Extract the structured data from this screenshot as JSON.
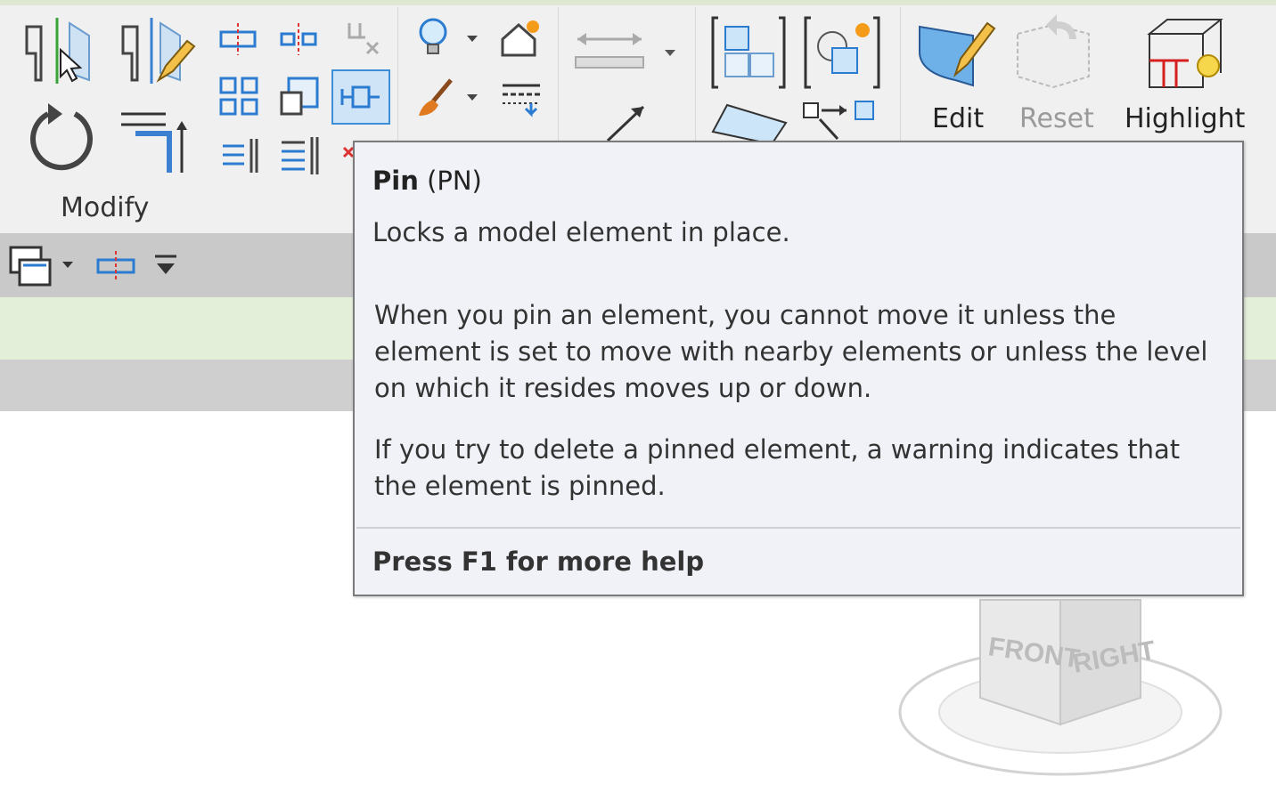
{
  "ribbon": {
    "modify_panel_label": "Modify",
    "edit_label": "Edit",
    "reset_label": "Reset",
    "highlight_label": "Highlight"
  },
  "tooltip": {
    "title": "Pin",
    "shortcut": "(PN)",
    "description": "Locks a model element in place.",
    "body_1": "When you pin an element, you cannot move it unless the element is set to move with nearby elements or unless the level on which it resides moves up or down.",
    "body_2": "If you try to delete a pinned element, a warning indicates that the element is pinned.",
    "help": "Press F1 for more help"
  },
  "viewcube": {
    "front_label": "FRONT",
    "right_label": "RIGHT"
  },
  "colors": {
    "accent_blue": "#2b7bd1",
    "selected_bg": "#cfe4f7",
    "tooltip_bg": "#f1f2f7",
    "ribbon_bg": "#f0f0f0",
    "options_bar_bg": "#c9c9c9",
    "status_strip_bg": "#e4efd9"
  }
}
